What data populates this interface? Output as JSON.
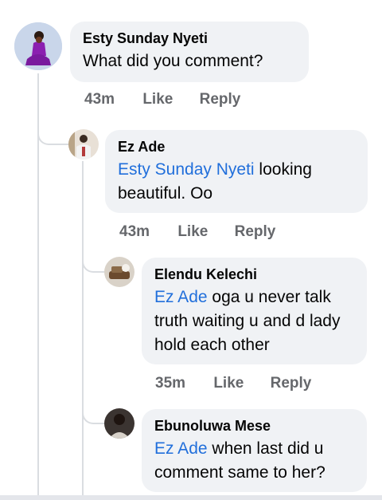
{
  "comments": [
    {
      "author": "Esty Sunday Nyeti",
      "mention": "",
      "text": "What did you comment?",
      "time": "43m",
      "like": "Like",
      "reply": "Reply"
    },
    {
      "author": "Ez Ade",
      "mention": "Esty Sunday Nyeti",
      "text": " looking beautiful. Oo",
      "time": "43m",
      "like": "Like",
      "reply": "Reply"
    },
    {
      "author": "Elendu Kelechi",
      "mention": "Ez Ade",
      "text": " oga u never talk truth waiting u and d lady hold each other",
      "time": "35m",
      "like": "Like",
      "reply": "Reply"
    },
    {
      "author": "Ebunoluwa Mese",
      "mention": "Ez Ade",
      "text": " when last did u comment same to her?",
      "time": "",
      "like": "",
      "reply": ""
    }
  ],
  "colors": {
    "bubble": "#f0f2f5",
    "mention": "#216fdb",
    "meta": "#65676b",
    "thread": "#dadde1"
  }
}
